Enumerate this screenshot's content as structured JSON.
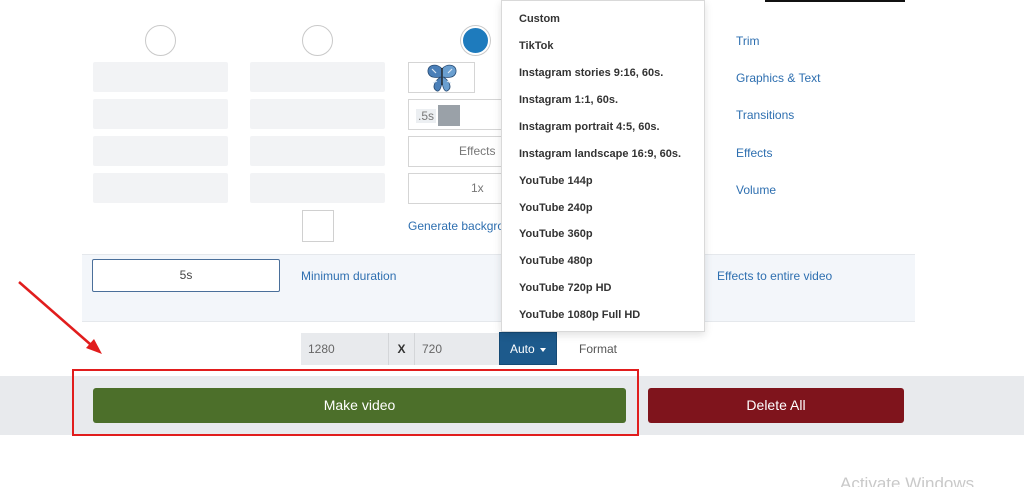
{
  "thumbnail": {
    "icon": "butterfly-icon"
  },
  "slide_settings": {
    "duration_value": ".5s",
    "effects_label": "Effects",
    "speed_label": "1x",
    "generate_background_link": "Generate background"
  },
  "sidebar_links": [
    "Trim",
    "Graphics & Text",
    "Transitions",
    "Effects",
    "Volume"
  ],
  "minimum_duration": {
    "value": "5s",
    "label": "Minimum duration",
    "effects_link": "Effects to entire video"
  },
  "dimensions": {
    "width": "1280",
    "separator": "X",
    "height": "720",
    "format_button": "Auto",
    "format_label": "Format"
  },
  "format_dropdown": {
    "items": [
      "Custom",
      "TikTok",
      "Instagram stories 9:16, 60s.",
      "Instagram 1:1, 60s.",
      "Instagram portrait 4:5, 60s.",
      "Instagram landscape 16:9, 60s.",
      "YouTube 144p",
      "YouTube 240p",
      "YouTube 360p",
      "YouTube 480p",
      "YouTube 720p HD",
      "YouTube 1080p Full HD"
    ]
  },
  "actions": {
    "make_video": "Make video",
    "delete_all": "Delete All"
  },
  "colors": {
    "make_video": "#4c6f2a",
    "delete_all": "#7f141c",
    "format_button": "#1d5a8c",
    "link": "#2e6fb0",
    "annotation": "#e11d1d"
  },
  "watermark": "Activate Windows"
}
